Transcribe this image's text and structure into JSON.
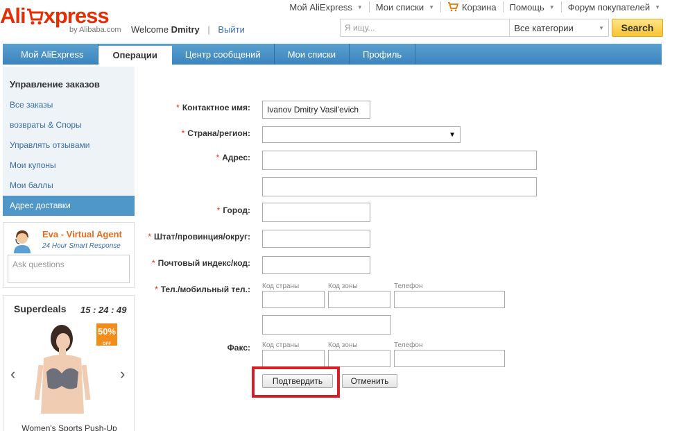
{
  "header": {
    "logo_ali": "Ali",
    "logo_x": "xpress",
    "logo_sub": "by Alibaba.com",
    "welcome_text": "Welcome",
    "user_name": "Dmitry",
    "logout": "Выйти",
    "topnav": [
      {
        "label": "Мой AliExpress"
      },
      {
        "label": "Мои списки"
      },
      {
        "label": "Корзина"
      },
      {
        "label": "Помощь"
      },
      {
        "label": "Форум покупателей"
      }
    ],
    "search": {
      "placeholder": "Я ищу...",
      "category": "Все категории",
      "button": "Search"
    }
  },
  "mainnav": {
    "tabs": [
      "Мой AliExpress",
      "Операции",
      "Центр сообщений",
      "Мои списки",
      "Профиль"
    ],
    "active": "Операции"
  },
  "sidebar": {
    "title": "Управление заказов",
    "items": [
      "Все заказы",
      "возвраты & Споры",
      "Управлять отзывами",
      "Мои купоны",
      "Мои баллы",
      "Адрес доставки"
    ],
    "active": "Адрес доставки"
  },
  "agent": {
    "name": "Eva - Virtual Agent",
    "sub": "24 Hour Smart Response",
    "placeholder": "Ask questions"
  },
  "deals": {
    "title": "Superdeals",
    "timer": "15 : 24 : 49",
    "badge": "50%",
    "badge_off": "OFF",
    "caption": "Women's Sports Push-Up"
  },
  "form": {
    "contact_label": "Контактное имя:",
    "contact_value": "Ivanov Dmitry Vasil'evich",
    "country_label": "Страна/регион:",
    "address_label": "Адрес:",
    "city_label": "Город:",
    "state_label": "Штат/провинция/округ:",
    "zip_label": "Почтовый индекс/код:",
    "phone_label": "Тел./мобильный тел.:",
    "fax_label": "Факс:",
    "hint_country_code": "Код страны",
    "hint_area_code": "Код зоны",
    "hint_phone": "Телефон",
    "confirm": "Подтвердить",
    "cancel": "Отменить"
  },
  "colors": {
    "accent": "#e62e04",
    "nav": "#3b84bf",
    "highlight": "#d5202a"
  }
}
